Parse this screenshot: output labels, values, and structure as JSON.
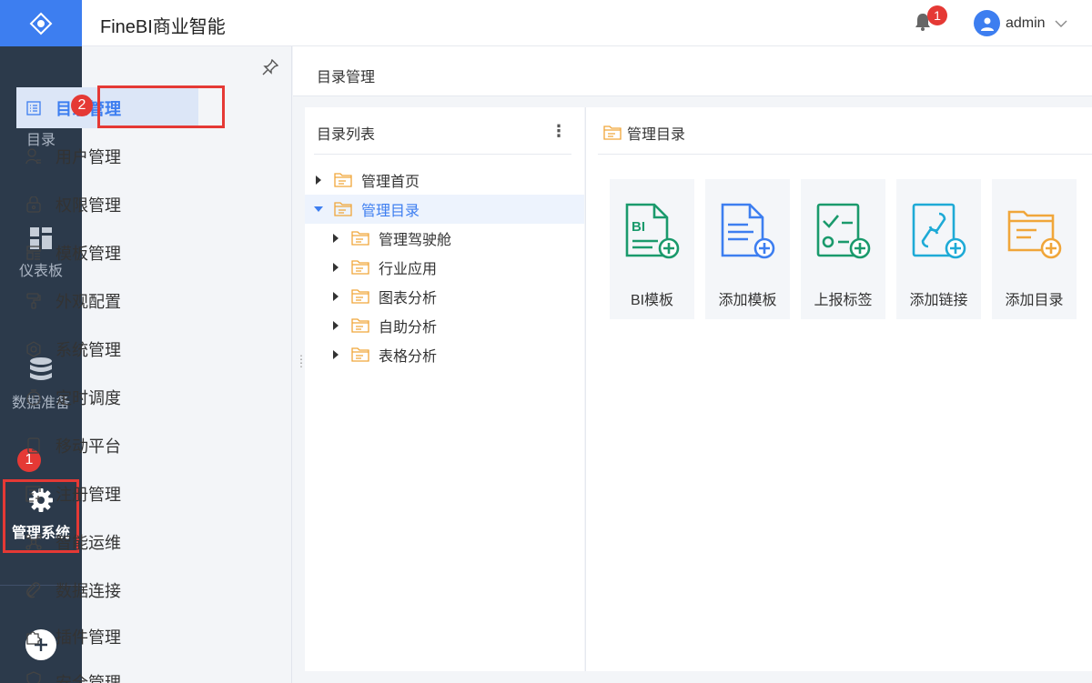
{
  "app": {
    "title": "FineBI商业智能"
  },
  "header": {
    "notification_count": "1",
    "username": "admin"
  },
  "rail": {
    "items": [
      {
        "label": "目录",
        "icon": "list-icon"
      },
      {
        "label": "仪表板",
        "icon": "dashboard-icon"
      },
      {
        "label": "数据准备",
        "icon": "database-icon"
      },
      {
        "label": "管理系统",
        "icon": "gear-icon"
      }
    ],
    "step1": "1"
  },
  "submenu": {
    "step2": "2",
    "items": [
      {
        "label": "目录管理",
        "icon": "directory-icon"
      },
      {
        "label": "用户管理",
        "icon": "user-icon"
      },
      {
        "label": "权限管理",
        "icon": "lock-icon"
      },
      {
        "label": "模板管理",
        "icon": "template-icon"
      },
      {
        "label": "外观配置",
        "icon": "paint-icon"
      },
      {
        "label": "系统管理",
        "icon": "settings-icon"
      },
      {
        "label": "定时调度",
        "icon": "timer-icon"
      },
      {
        "label": "移动平台",
        "icon": "mobile-icon"
      },
      {
        "label": "注册管理",
        "icon": "register-icon"
      },
      {
        "label": "智能运维",
        "icon": "ops-icon"
      },
      {
        "label": "数据连接",
        "icon": "link-icon"
      },
      {
        "label": "插件管理",
        "icon": "plugin-icon"
      },
      {
        "label": "安全管理",
        "icon": "shield-icon"
      }
    ]
  },
  "breadcrumb": {
    "label": "目录管理"
  },
  "directory_list": {
    "title": "目录列表",
    "more": "⋮",
    "tree": [
      {
        "label": "管理首页",
        "level": 0,
        "expanded": false
      },
      {
        "label": "管理目录",
        "level": 0,
        "expanded": true
      },
      {
        "label": "管理驾驶舱",
        "level": 1,
        "expanded": false
      },
      {
        "label": "行业应用",
        "level": 1,
        "expanded": false
      },
      {
        "label": "图表分析",
        "level": 1,
        "expanded": false
      },
      {
        "label": "自助分析",
        "level": 1,
        "expanded": false
      },
      {
        "label": "表格分析",
        "level": 1,
        "expanded": false
      }
    ]
  },
  "management": {
    "title": "管理目录",
    "cards": [
      {
        "label": "BI模板",
        "icon": "bi-template-add-icon",
        "color": "#1a9a6c"
      },
      {
        "label": "添加模板",
        "icon": "template-add-icon",
        "color": "#3d7ef0"
      },
      {
        "label": "上报标签",
        "icon": "report-tag-add-icon",
        "color": "#1a9a6c"
      },
      {
        "label": "添加链接",
        "icon": "link-add-icon",
        "color": "#1eaad6"
      },
      {
        "label": "添加目录",
        "icon": "folder-add-icon",
        "color": "#f0a63a"
      }
    ]
  },
  "colors": {
    "accent": "#3d7ef0",
    "rail": "#2c3a4b",
    "highlight": "#e53935"
  }
}
